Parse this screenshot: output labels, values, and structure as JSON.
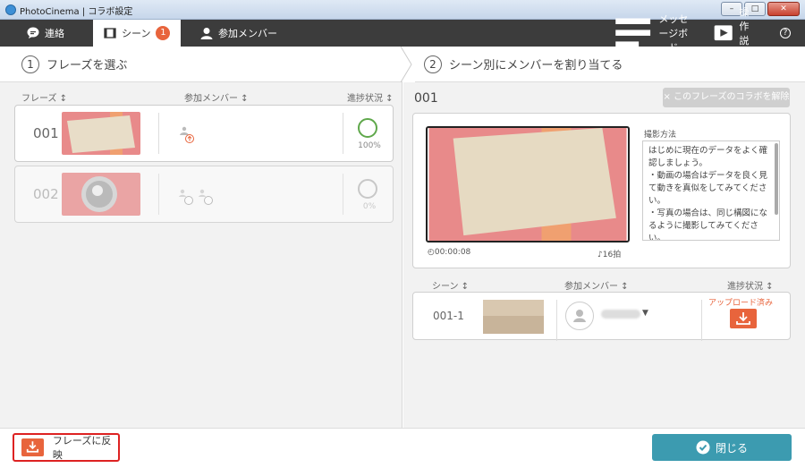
{
  "window": {
    "title": "PhotoCinema | コラボ設定",
    "buttons": [
      "–",
      "□",
      "✕"
    ]
  },
  "topbar": {
    "tabs": [
      {
        "label": "連絡",
        "icon": "chat-icon"
      },
      {
        "label": "シーン",
        "icon": "film-icon",
        "badge": "1"
      },
      {
        "label": "参加メンバー",
        "icon": "person-icon"
      }
    ],
    "message_board": "メッセージボード",
    "manual": "操作説明",
    "help": "?"
  },
  "steps": {
    "step1_num": "1",
    "step1": "フレーズを選ぶ",
    "step2_num": "2",
    "step2": "シーン別にメンバーを割り当てる"
  },
  "left": {
    "headers": {
      "phrase": "フレーズ ↕",
      "members": "参加メンバー ↕",
      "progress": "進捗状況 ↕"
    },
    "phrases": [
      {
        "num": "001",
        "progress_text": "100%",
        "progress": 1.0
      },
      {
        "num": "002",
        "progress_text": "0%",
        "progress": 0.0
      }
    ]
  },
  "right": {
    "title": "001",
    "unlink_button": "× このフレーズのコラボを解除",
    "timecode": "◴00:00:08",
    "beats": "♪16拍",
    "howto_label": "撮影方法",
    "howto_text": "はじめに現在のデータをよく確認しましょう。\n・動画の場合はデータを良く見て動きを真似をしてみてください。\n・写真の場合は、同じ構図になるように撮影してみてください。\n※何度でもやり直しができますので、気軽にトライしてみてくださ",
    "scene_headers": {
      "scene": "シーン ↕",
      "members": "参加メンバー ↕",
      "progress": "進捗状況 ↕"
    },
    "scene": {
      "num": "001-1",
      "upload_status": "アップロード済み",
      "dropdown": "▼"
    }
  },
  "bottom": {
    "reflect_button": "フレーズに反映",
    "close_button": "閉じる"
  },
  "colors": {
    "accent": "#e8643c",
    "teal": "#3c9bb0",
    "dark_bar": "#3c3c3c"
  }
}
